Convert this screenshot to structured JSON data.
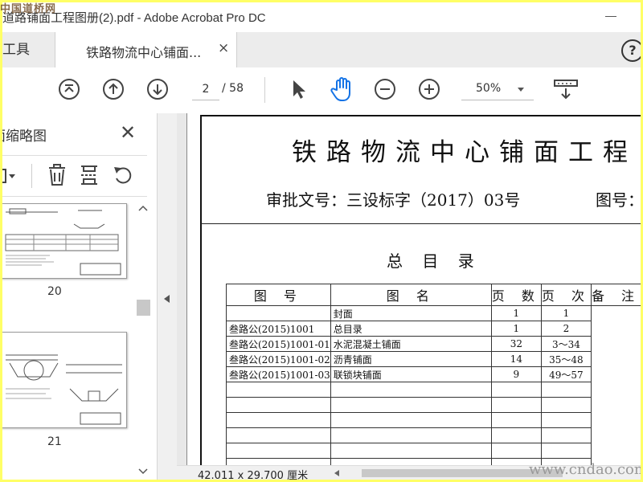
{
  "window": {
    "title": "道路铺面工程图册(2).pdf - Adobe Acrobat Pro DC",
    "watermark_top": "中国道桥网"
  },
  "tabs": {
    "tools_label": "工具",
    "document_label": "铁路物流中心铺面...",
    "close_symbol": "×",
    "help_symbol": "?"
  },
  "toolbar": {
    "current_page": "2",
    "total_pages": "/ 58",
    "zoom": "50%"
  },
  "sidebar": {
    "title": "页面缩略图",
    "close_symbol": "✕",
    "thumbnails": [
      {
        "page_label": "20"
      },
      {
        "page_label": "21"
      }
    ]
  },
  "document": {
    "title": "铁路物流中心铺面工程",
    "approval": "审批文号：三设标字（2017）03号",
    "figure_number_label": "图号：",
    "toc_heading": "总 目 录",
    "toc_columns": [
      "图 号",
      "图 名",
      "页 数",
      "页 次",
      "备 注"
    ],
    "toc_rows": [
      {
        "fig_no": "",
        "name": "封面",
        "pages": "1",
        "page_range": "1"
      },
      {
        "fig_no": "叁路公(2015)1001",
        "name": "总目录",
        "pages": "1",
        "page_range": "2"
      },
      {
        "fig_no": "叁路公(2015)1001-01",
        "name": "水泥混凝土铺面",
        "pages": "32",
        "page_range": "3～34"
      },
      {
        "fig_no": "叁路公(2015)1001-02",
        "name": "沥青铺面",
        "pages": "14",
        "page_range": "35～48"
      },
      {
        "fig_no": "叁路公(2015)1001-03",
        "name": "联锁块铺面",
        "pages": "9",
        "page_range": "49～57"
      }
    ]
  },
  "statusbar": {
    "page_size": "42.011 x 29.700 厘米"
  },
  "watermark_bottom": "www.cndao.com",
  "colors": {
    "frame_border": "#ffff66",
    "accent_blue": "#1473e6"
  }
}
